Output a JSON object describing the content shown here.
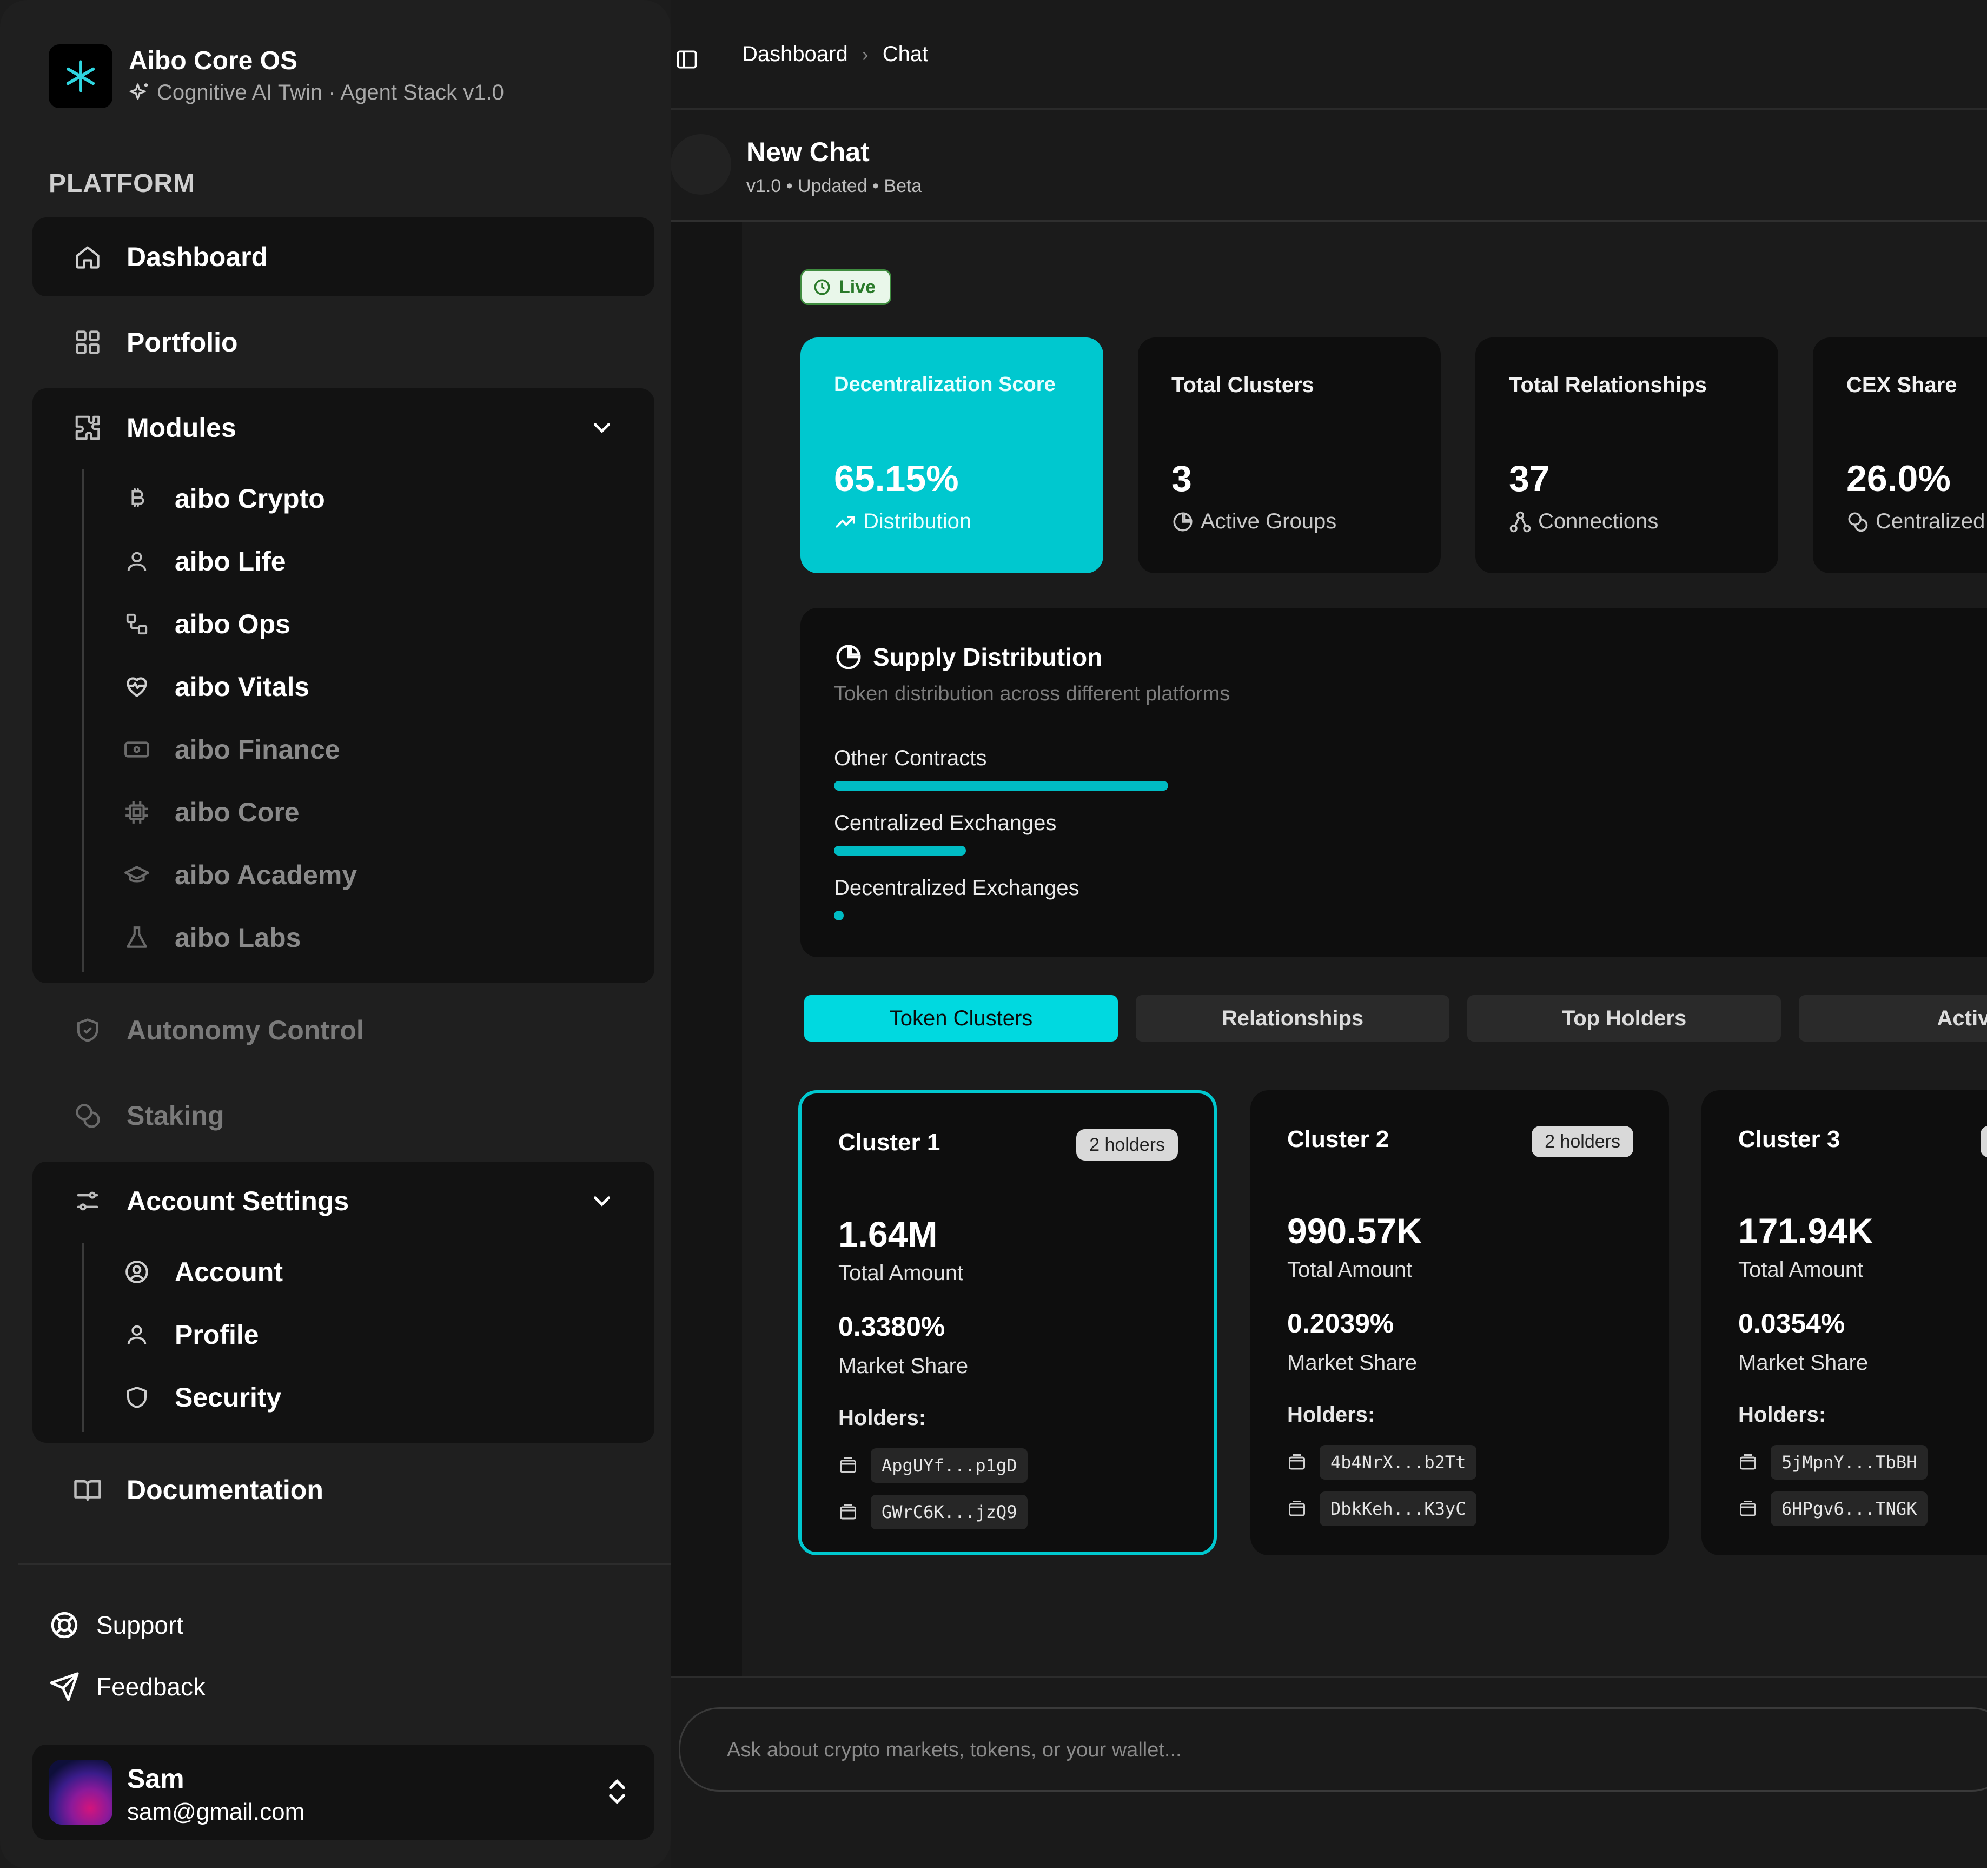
{
  "brand": {
    "title": "Aibo Core OS",
    "subtitle": "Cognitive AI Twin · Agent Stack v1.0"
  },
  "sidebar": {
    "group_label": "PLATFORM",
    "dashboard": "Dashboard",
    "portfolio": "Portfolio",
    "modules": {
      "label": "Modules",
      "items": [
        {
          "label": "aibo Crypto",
          "icon": "bitcoin-icon"
        },
        {
          "label": "aibo Life",
          "icon": "user-icon"
        },
        {
          "label": "aibo Ops",
          "icon": "workflow-icon"
        },
        {
          "label": "aibo Vitals",
          "icon": "heart-pulse-icon"
        },
        {
          "label": "aibo Finance",
          "icon": "banknote-icon"
        },
        {
          "label": "aibo Core",
          "icon": "cpu-icon"
        },
        {
          "label": "aibo Academy",
          "icon": "graduation-cap-icon"
        },
        {
          "label": "aibo Labs",
          "icon": "flask-icon"
        }
      ]
    },
    "autonomy": "Autonomy Control",
    "staking": "Staking",
    "account_settings": {
      "label": "Account Settings",
      "items": [
        {
          "label": "Account",
          "icon": "user-circle-icon"
        },
        {
          "label": "Profile",
          "icon": "user-icon"
        },
        {
          "label": "Security",
          "icon": "shield-icon"
        }
      ]
    },
    "documentation": "Documentation",
    "support": "Support",
    "feedback": "Feedback",
    "user": {
      "name": "Sam",
      "email": "sam@gmail.com"
    }
  },
  "topbar": {
    "crumbs": [
      "Dashboard",
      "Chat"
    ]
  },
  "chat": {
    "title": "New Chat",
    "meta": "v1.0  • Updated  • Beta"
  },
  "live_label": "Live",
  "stats": [
    {
      "title": "Decentralization Score",
      "value": "65.15%",
      "sub": "Distribution"
    },
    {
      "title": "Total Clusters",
      "value": "3",
      "sub": "Active Groups"
    },
    {
      "title": "Total Relationships",
      "value": "37",
      "sub": "Connections"
    },
    {
      "title": "CEX Share",
      "value": "26.0%",
      "sub": "Centralized"
    }
  ],
  "supply": {
    "title": "Supply Distribution",
    "subtitle": "Token distribution across different platforms",
    "bars": [
      {
        "label": "Other Contracts",
        "fill": 0.289
      },
      {
        "label": "Centralized Exchanges",
        "fill": 0.114
      },
      {
        "label": "Decentralized Exchanges",
        "fill": 0.004
      }
    ]
  },
  "tabs": [
    "Token Clusters",
    "Relationships",
    "Top Holders",
    "Activity"
  ],
  "clusters": [
    {
      "name": "Cluster 1",
      "badge": "2 holders",
      "amount": "1.64M",
      "amount_label": "Total Amount",
      "share": "0.3380%",
      "share_label": "Market Share",
      "holders_label": "Holders:",
      "holders": [
        "ApgUYf...p1gD",
        "GWrC6K...jzQ9"
      ]
    },
    {
      "name": "Cluster 2",
      "badge": "2 holders",
      "amount": "990.57K",
      "amount_label": "Total Amount",
      "share": "0.2039%",
      "share_label": "Market Share",
      "holders_label": "Holders:",
      "holders": [
        "4b4NrX...b2Tt",
        "DbkKeh...K3yC"
      ]
    },
    {
      "name": "Cluster 3",
      "badge": "",
      "amount": "171.94K",
      "amount_label": "Total Amount",
      "share": "0.0354%",
      "share_label": "Market Share",
      "holders_label": "Holders:",
      "holders": [
        "5jMpnY...TbBH",
        "6HPgv6...TNGK"
      ]
    }
  ],
  "input": {
    "placeholder": "Ask about crypto markets, tokens, or your wallet..."
  },
  "colors": {
    "accent": "#00c8cf",
    "live": "#3f8c3f"
  }
}
